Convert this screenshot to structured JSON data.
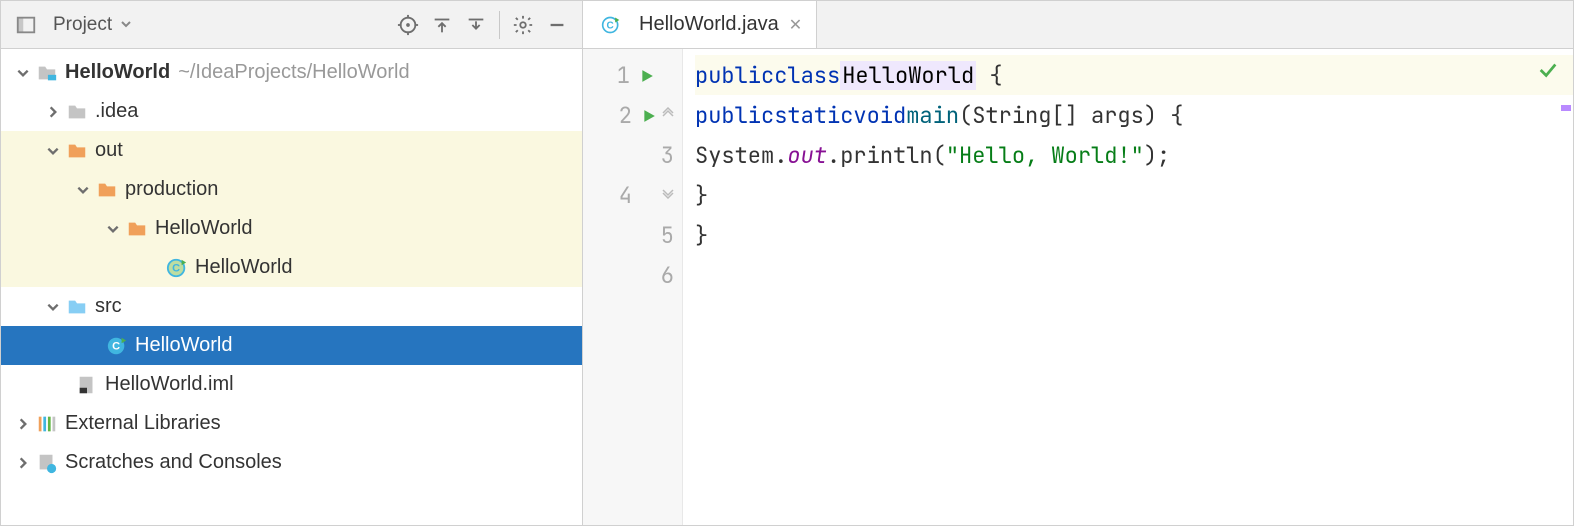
{
  "toolbar": {
    "project_label": "Project"
  },
  "tree": {
    "root": {
      "name": "HelloWorld",
      "path": "~/IdeaProjects/HelloWorld"
    },
    "idea": ".idea",
    "out": "out",
    "production": "production",
    "hw_out": "HelloWorld",
    "hw_class": "HelloWorld",
    "src": "src",
    "hw_src": "HelloWorld",
    "iml": "HelloWorld.iml",
    "ext_lib": "External Libraries",
    "scratches": "Scratches and Consoles"
  },
  "tabs": [
    {
      "label": "HelloWorld.java"
    }
  ],
  "editor": {
    "lines": {
      "l1_kw1": "public",
      "l1_kw2": "class",
      "l1_cls": "HelloWorld",
      "l1_brace": " {",
      "l2_kw1": "public",
      "l2_kw2": "static",
      "l2_kw3": "void",
      "l2_fn": "main",
      "l2_rest": "(String[] args) {",
      "l3_pre": "System.",
      "l3_out": "out",
      "l3_mid": ".println(",
      "l3_str": "\"Hello, World!\"",
      "l3_end": ");",
      "l4": "}",
      "l5": "}"
    },
    "line_numbers": [
      "1",
      "2",
      "3",
      "4",
      "5",
      "6"
    ]
  }
}
